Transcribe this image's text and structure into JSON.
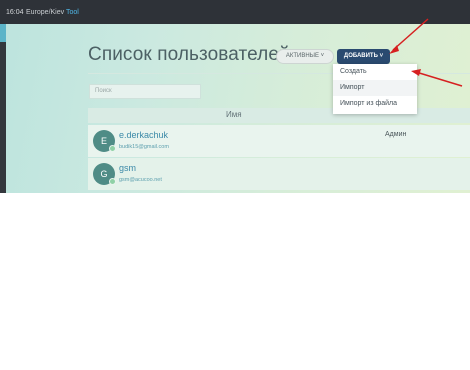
{
  "topbar": {
    "time": "16:04",
    "timezone": "Europe/Kiev",
    "tool_label": "Tool"
  },
  "page": {
    "title": "Список пользователей"
  },
  "filters": {
    "active_label": "АКТИВНЫЕ ˅"
  },
  "add_button": {
    "label": "ДОБАВИТЬ ˅"
  },
  "dropdown": {
    "items": [
      "Создать",
      "Импорт",
      "Импорт из файла"
    ]
  },
  "search": {
    "placeholder": "Поиск"
  },
  "table": {
    "column_name": "Имя",
    "rows": [
      {
        "initial": "E",
        "name": "e.derkachuk",
        "email": "budik15@gmail.com",
        "role": "Админ"
      },
      {
        "initial": "G",
        "name": "gsm",
        "email": "gsm@acucoo.net",
        "role": ""
      }
    ]
  },
  "colors": {
    "add_button_bg": "#2a4a70",
    "annotation_arrow": "#d62020",
    "link_text": "#3c8aa8"
  }
}
